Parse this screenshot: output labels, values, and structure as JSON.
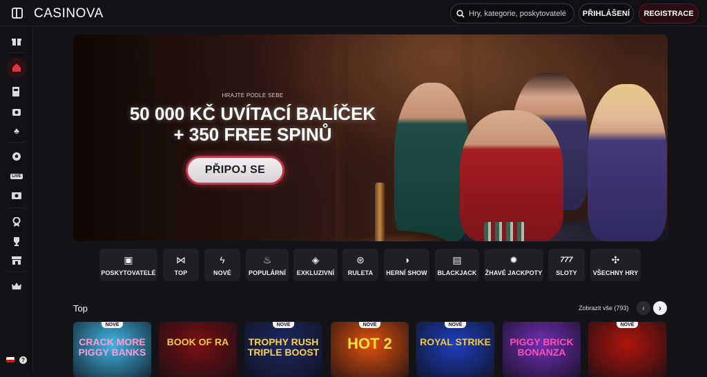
{
  "header": {
    "logo": "CASINOVA",
    "search_placeholder": "Hry, kategorie, poskytovatelé",
    "login_label": "PŘIHLÁŠENÍ",
    "register_label": "REGISTRACE"
  },
  "sidebar": {
    "items": [
      {
        "icon": "gift-icon"
      },
      {
        "icon": "home-icon",
        "active": true
      },
      {
        "icon": "slot-machine-icon"
      },
      {
        "icon": "poker-chip-icon"
      },
      {
        "icon": "clover-icon"
      },
      {
        "icon": "football-icon"
      },
      {
        "icon": "live-icon"
      },
      {
        "icon": "virtual-sports-icon"
      },
      {
        "icon": "award-icon"
      },
      {
        "icon": "trophy-icon"
      },
      {
        "icon": "shop-icon"
      },
      {
        "icon": "vip-crown-icon"
      }
    ],
    "language": "cs",
    "help": "?"
  },
  "hero": {
    "kicker": "HRAJTE PODLE SEBE",
    "title_line1": "50 000 KČ UVÍTACÍ BALÍČEK",
    "title_line2": "+ 350 FREE SPINŮ",
    "cta": "PŘIPOJ SE"
  },
  "categories": [
    {
      "label": "POSKYTOVATELÉ",
      "icon": "providers-icon",
      "glyph": "▣"
    },
    {
      "label": "TOP",
      "icon": "bowtie-icon",
      "glyph": "⋈"
    },
    {
      "label": "NOVÉ",
      "icon": "lightning-icon",
      "glyph": "ϟ"
    },
    {
      "label": "POPULÁRNÍ",
      "icon": "flame-icon",
      "glyph": "♨"
    },
    {
      "label": "EXKLUZIVNÍ",
      "icon": "diamond-icon",
      "glyph": "◈"
    },
    {
      "label": "RULETA",
      "icon": "roulette-icon",
      "glyph": "⊛"
    },
    {
      "label": "HERNÍ SHOW",
      "icon": "mask-icon",
      "glyph": "◑"
    },
    {
      "label": "BLACKJACK",
      "icon": "cards-icon",
      "glyph": "▤"
    },
    {
      "label": "ŽHAVÉ JACKPOTY",
      "icon": "hot-jackpot-icon",
      "glyph": "✹"
    },
    {
      "label": "SLOTY",
      "icon": "777-icon",
      "glyph": "777"
    },
    {
      "label": "VŠECHNY HRY",
      "icon": "all-games-icon",
      "glyph": "✣"
    }
  ],
  "top_section": {
    "title": "Top",
    "show_all": "Zobrazit vše (793)"
  },
  "games": [
    {
      "title": "CRACK MORE PIGGY BANKS",
      "badge": "NOVÉ",
      "bg": "#3fb6e6",
      "color": "#ff9ad1"
    },
    {
      "title": "BOOK OF RA",
      "badge": "",
      "bg": "#7a1012",
      "color": "#f4c84a"
    },
    {
      "title": "TROPHY RUSH TRIPLE BOOST",
      "badge": "NOVÉ",
      "bg": "#1c2a66",
      "color": "#ffd24a"
    },
    {
      "title": "HOT 2",
      "badge": "NOVÉ",
      "bg": "#e0500e",
      "color": "#ffdf3a"
    },
    {
      "title": "ROYAL STRIKE",
      "badge": "NOVÉ",
      "bg": "#1d3fbf",
      "color": "#f3c94a"
    },
    {
      "title": "PIGGY BRICK BONANZA",
      "badge": "",
      "bg": "#6f2fb6",
      "color": "#ff4fb2"
    },
    {
      "title": "",
      "badge": "NOVÉ",
      "bg": "#b0150c",
      "color": "#ffd24a"
    }
  ],
  "colors": {
    "accent": "#c4364b",
    "background": "#141418"
  }
}
